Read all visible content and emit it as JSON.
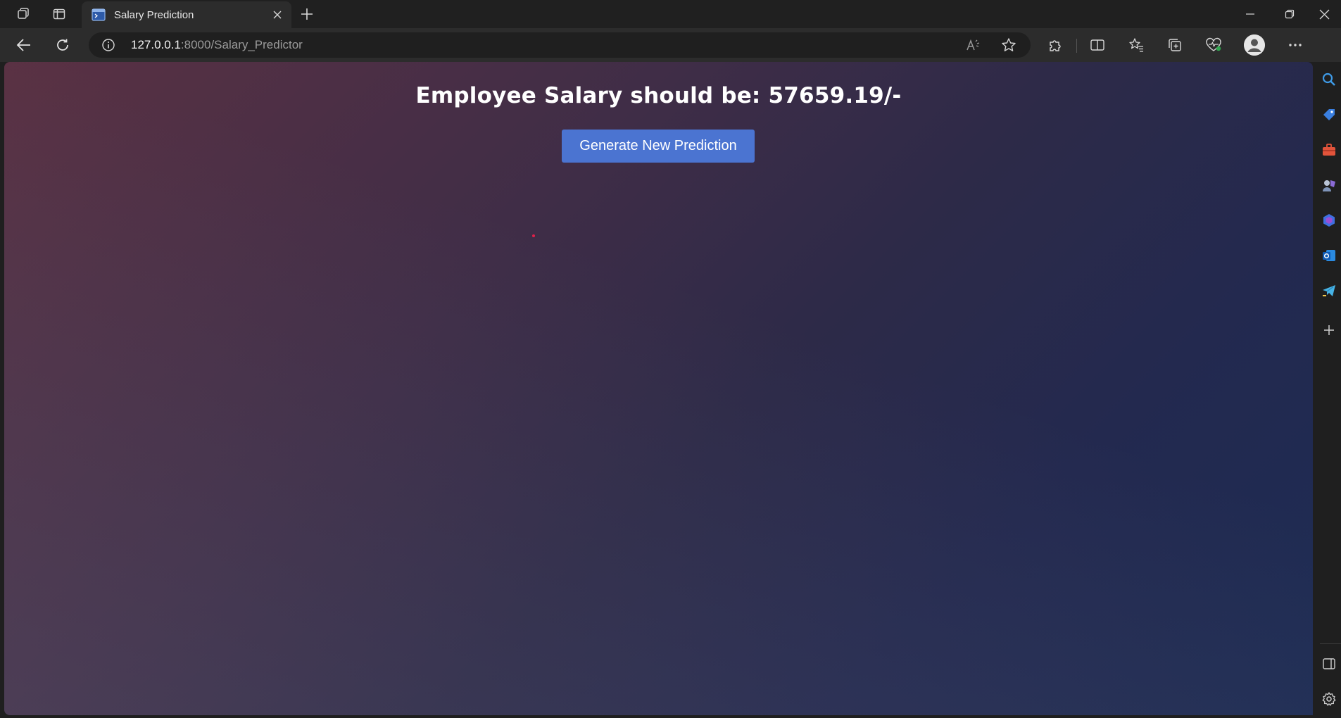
{
  "browser": {
    "tab": {
      "title": "Salary Prediction",
      "favicon": "terminal-window-icon"
    },
    "address_bar": {
      "host": "127.0.0.1",
      "path": ":8000/Salary_Predictor"
    },
    "toolbar_icons": [
      "back-icon",
      "refresh-icon",
      "info-icon",
      "read-aloud-icon",
      "favorite-star-icon",
      "extensions-icon",
      "split-screen-icon",
      "favorites-icon",
      "collections-icon",
      "browser-essentials-icon",
      "profile-avatar",
      "more-icon"
    ],
    "sidebar_icons": [
      "search-icon",
      "shopping-tag-icon",
      "tools-icon",
      "games-icon",
      "copilot-icon",
      "outlook-icon",
      "telegram-icon",
      "add-icon",
      "sidebar-toggle-icon",
      "settings-icon"
    ]
  },
  "page": {
    "heading": "Employee Salary should be: 57659.19/-",
    "prediction_value": "57659.19",
    "button_label": "Generate New Prediction"
  },
  "colors": {
    "button": "#4b74d1",
    "background_start": "#5a3143",
    "background_end": "#1d2c54"
  }
}
